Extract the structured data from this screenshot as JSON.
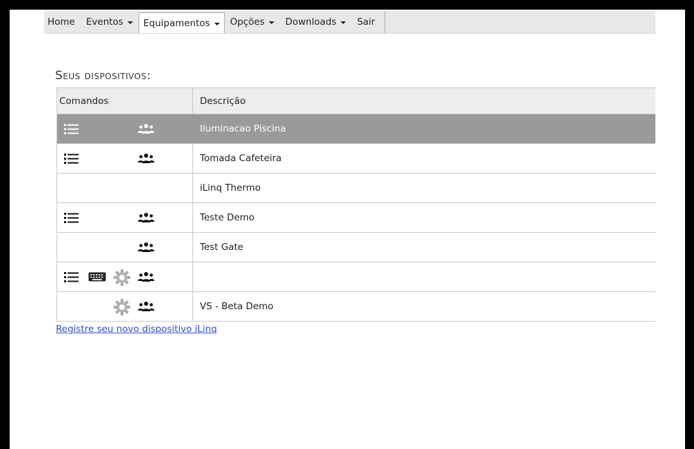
{
  "nav": {
    "items": [
      {
        "label": "Home",
        "has_caret": false
      },
      {
        "label": "Eventos",
        "has_caret": true
      },
      {
        "label": "Equipamentos",
        "has_caret": true,
        "active": true
      },
      {
        "label": "Opções",
        "has_caret": true
      },
      {
        "label": "Downloads",
        "has_caret": true
      },
      {
        "label": "Sair",
        "has_caret": false
      }
    ]
  },
  "section_title": "Seus dispositivos:",
  "table": {
    "headers": {
      "commands": "Comandos",
      "description": "Descrição"
    },
    "rows": [
      {
        "description": "Iluminacao Piscina",
        "icons": [
          "list-icon",
          "group-icon"
        ],
        "selected": true
      },
      {
        "description": "Tomada Cafeteira",
        "icons": [
          "list-icon",
          "group-icon"
        ],
        "selected": false
      },
      {
        "description": "iLinq Thermo",
        "icons": [],
        "selected": false
      },
      {
        "description": "Teste Demo",
        "icons": [
          "list-icon",
          "group-icon"
        ],
        "selected": false
      },
      {
        "description": "Test Gate",
        "icons": [
          "group-icon"
        ],
        "selected": false
      },
      {
        "description": "",
        "icons": [
          "list-icon",
          "keyboard-icon",
          "gear-icon",
          "group-icon"
        ],
        "selected": false
      },
      {
        "description": "VS - Beta Demo",
        "icons": [
          "gear-icon",
          "group-icon"
        ],
        "selected": false
      }
    ]
  },
  "register_link": "Registre seu novo dispositivo iLinq",
  "colors": {
    "selected_row": "#9a9a9a",
    "link": "#2b4dd6",
    "navbar_bg": "#e8e8e8"
  }
}
